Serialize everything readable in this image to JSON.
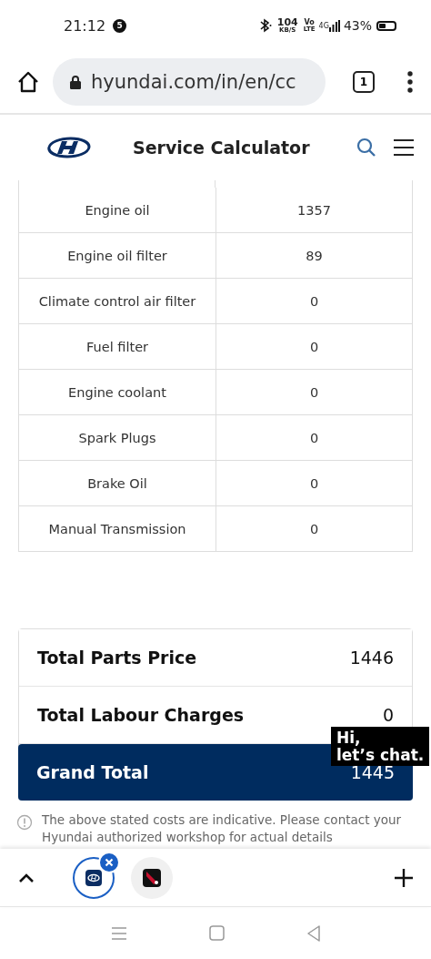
{
  "status_bar": {
    "time": "21:12",
    "notification_count": "5",
    "speed": "104",
    "speed_unit": "KB/S",
    "volte_top": "Vo",
    "volte_bottom": "LTE",
    "network": "4G",
    "battery": "43%"
  },
  "browser": {
    "url": "hyundai.com/in/en/cc",
    "tab_count": "1"
  },
  "header": {
    "title": "Service Calculator"
  },
  "parts_table": {
    "rows": [
      {
        "part": "Engine oil",
        "price": "1357"
      },
      {
        "part": "Engine oil filter",
        "price": "89"
      },
      {
        "part": "Climate control air filter",
        "price": "0"
      },
      {
        "part": "Fuel filter",
        "price": "0"
      },
      {
        "part": "Engine coolant",
        "price": "0"
      },
      {
        "part": "Spark Plugs",
        "price": "0"
      },
      {
        "part": "Brake Oil",
        "price": "0"
      },
      {
        "part": "Manual Transmission",
        "price": "0"
      }
    ]
  },
  "summary": [
    {
      "kind": "plain",
      "label": "Total Parts Price",
      "value": "1446"
    },
    {
      "kind": "plain",
      "label": "Total Labour Charges",
      "value": "0"
    },
    {
      "kind": "grand",
      "label": "Grand Total",
      "value": "1445"
    }
  ],
  "chat_bubble": {
    "line1": "Hi,",
    "line2": "let’s chat."
  },
  "disclaimer": {
    "line1": "The above stated costs are indicative. Please contact your",
    "line2": "Hyundai authorized workshop for actual details"
  },
  "tab_strip": {
    "tabs": [
      {
        "kind": "hyundai",
        "selected": true
      },
      {
        "kind": "bhp",
        "selected": false
      }
    ]
  }
}
